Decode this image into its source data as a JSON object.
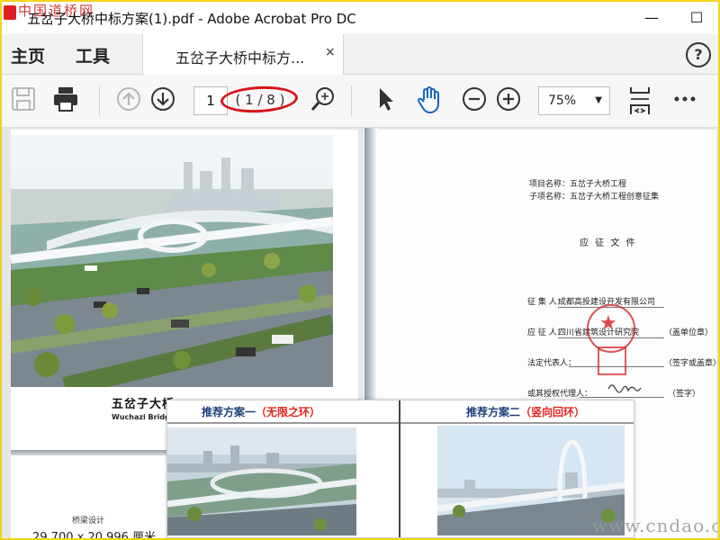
{
  "window": {
    "title": "五岔子大桥中标方案(1).pdf - Adobe Acrobat Pro DC",
    "minimize": "—",
    "maximize": "☐",
    "watermark": "中国道桥网"
  },
  "tabs": {
    "home": "主页",
    "tools": "工具",
    "document": "五岔子大桥中标方...",
    "close": "×"
  },
  "toolbar": {
    "page_number": "1",
    "page_count": "( 1 / 8 )",
    "zoom": "75%",
    "zoom_caret": "▼"
  },
  "document": {
    "left_page": {
      "caption_cn": "五岔子大桥",
      "caption_en": "Wuchazi Bridge",
      "footer_fragment": "桥梁设计"
    },
    "right_page": {
      "project_name": "项目名称：五岔子大桥工程",
      "sub_project": "子项名称：五岔子大桥工程创意征集",
      "heading": "应 征 文 件",
      "organizer_label": "征 集 人：",
      "organizer_value": "成都高投建设开发有限公司",
      "applicant_label": "应 征 人：",
      "applicant_value": "四川省建筑设计研究院",
      "applicant_note": "（盖单位章）",
      "legal_rep_label": "法定代表人：",
      "legal_rep_note": "（签字或盖章）",
      "agent_label": "或其授权代理人：",
      "agent_note": "（签字）"
    },
    "overlay": {
      "scheme1_title": "推荐方案一",
      "scheme1_name": "（无限之环）",
      "scheme2_title": "推荐方案二",
      "scheme2_name": "（竖向回环）"
    }
  },
  "statusbar": {
    "page_size": "29.700 x 20.996 厘米"
  },
  "watermark_bottom": "www.cndao.com",
  "colors": {
    "accent_blue": "#1565c0",
    "annotation_red": "#d8141a",
    "titlebar_border": "#f2d51a"
  }
}
